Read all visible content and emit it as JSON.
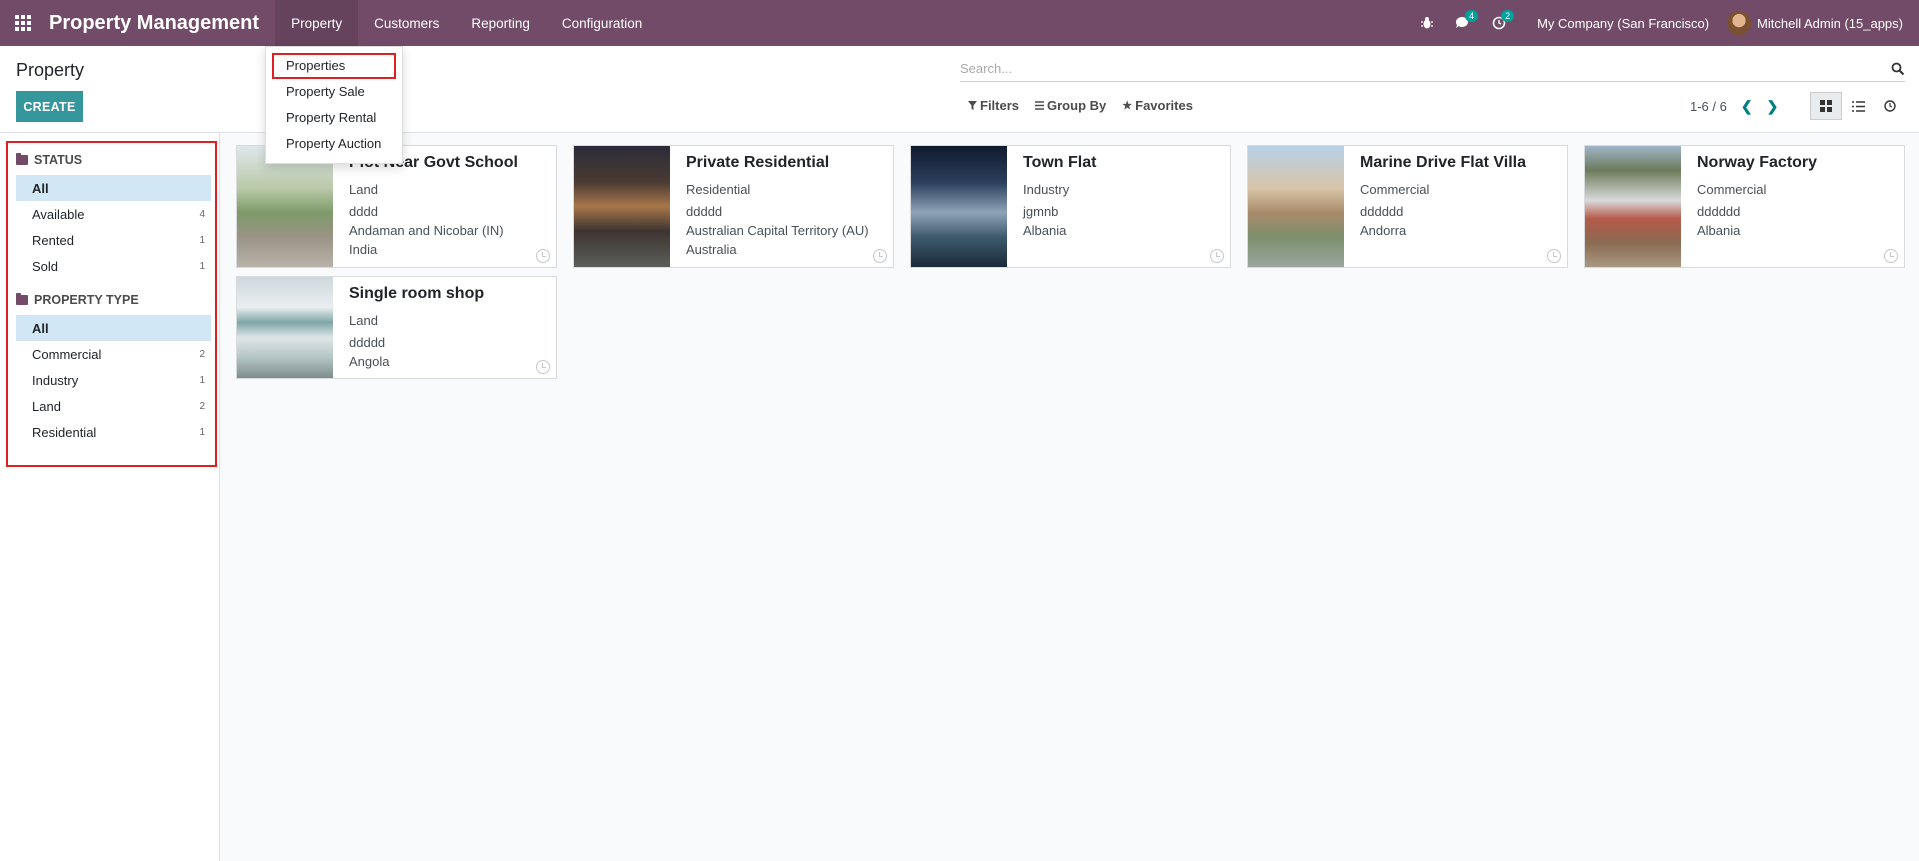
{
  "navbar": {
    "app_title": "Property Management",
    "menu": [
      "Property",
      "Customers",
      "Reporting",
      "Configuration"
    ],
    "messages_count": "4",
    "activities_count": "2",
    "company": "My Company (San Francisco)",
    "user": "Mitchell Admin (15_apps)"
  },
  "dropdown": {
    "items": [
      "Properties",
      "Property Sale",
      "Property Rental",
      "Property Auction"
    ]
  },
  "control_panel": {
    "title": "Property",
    "create_label": "CREATE",
    "search_placeholder": "Search...",
    "filters_label": "Filters",
    "groupby_label": "Group By",
    "favorites_label": "Favorites",
    "pager": "1-6 / 6"
  },
  "sidebar": {
    "status": {
      "title": "STATUS",
      "items": [
        {
          "label": "All",
          "count": ""
        },
        {
          "label": "Available",
          "count": "4"
        },
        {
          "label": "Rented",
          "count": "1"
        },
        {
          "label": "Sold",
          "count": "1"
        }
      ]
    },
    "property_type": {
      "title": "PROPERTY TYPE",
      "items": [
        {
          "label": "All",
          "count": ""
        },
        {
          "label": "Commercial",
          "count": "2"
        },
        {
          "label": "Industry",
          "count": "1"
        },
        {
          "label": "Land",
          "count": "2"
        },
        {
          "label": "Residential",
          "count": "1"
        }
      ]
    }
  },
  "cards": [
    {
      "title": "Plot Near Govt School",
      "type": "Land",
      "code": "dddd",
      "state": "Andaman and Nicobar (IN)",
      "country": "India"
    },
    {
      "title": "Private Residential",
      "type": "Residential",
      "code": "ddddd",
      "state": "Australian Capital Territory (AU)",
      "country": "Australia"
    },
    {
      "title": "Town Flat",
      "type": "Industry",
      "code": "jgmnb",
      "state": "",
      "country": "Albania"
    },
    {
      "title": "Marine Drive Flat Villa",
      "type": "Commercial",
      "code": "dddddd",
      "state": "",
      "country": "Andorra"
    },
    {
      "title": "Norway Factory",
      "type": "Commercial",
      "code": "dddddd",
      "state": "",
      "country": "Albania"
    },
    {
      "title": "Single room shop",
      "type": "Land",
      "code": "ddddd",
      "state": "",
      "country": "Angola"
    }
  ],
  "colors": {
    "navbar": "#714b67",
    "primary_button": "#35979c",
    "highlight_border": "#e02020",
    "active_filter": "#d2e7f5"
  }
}
